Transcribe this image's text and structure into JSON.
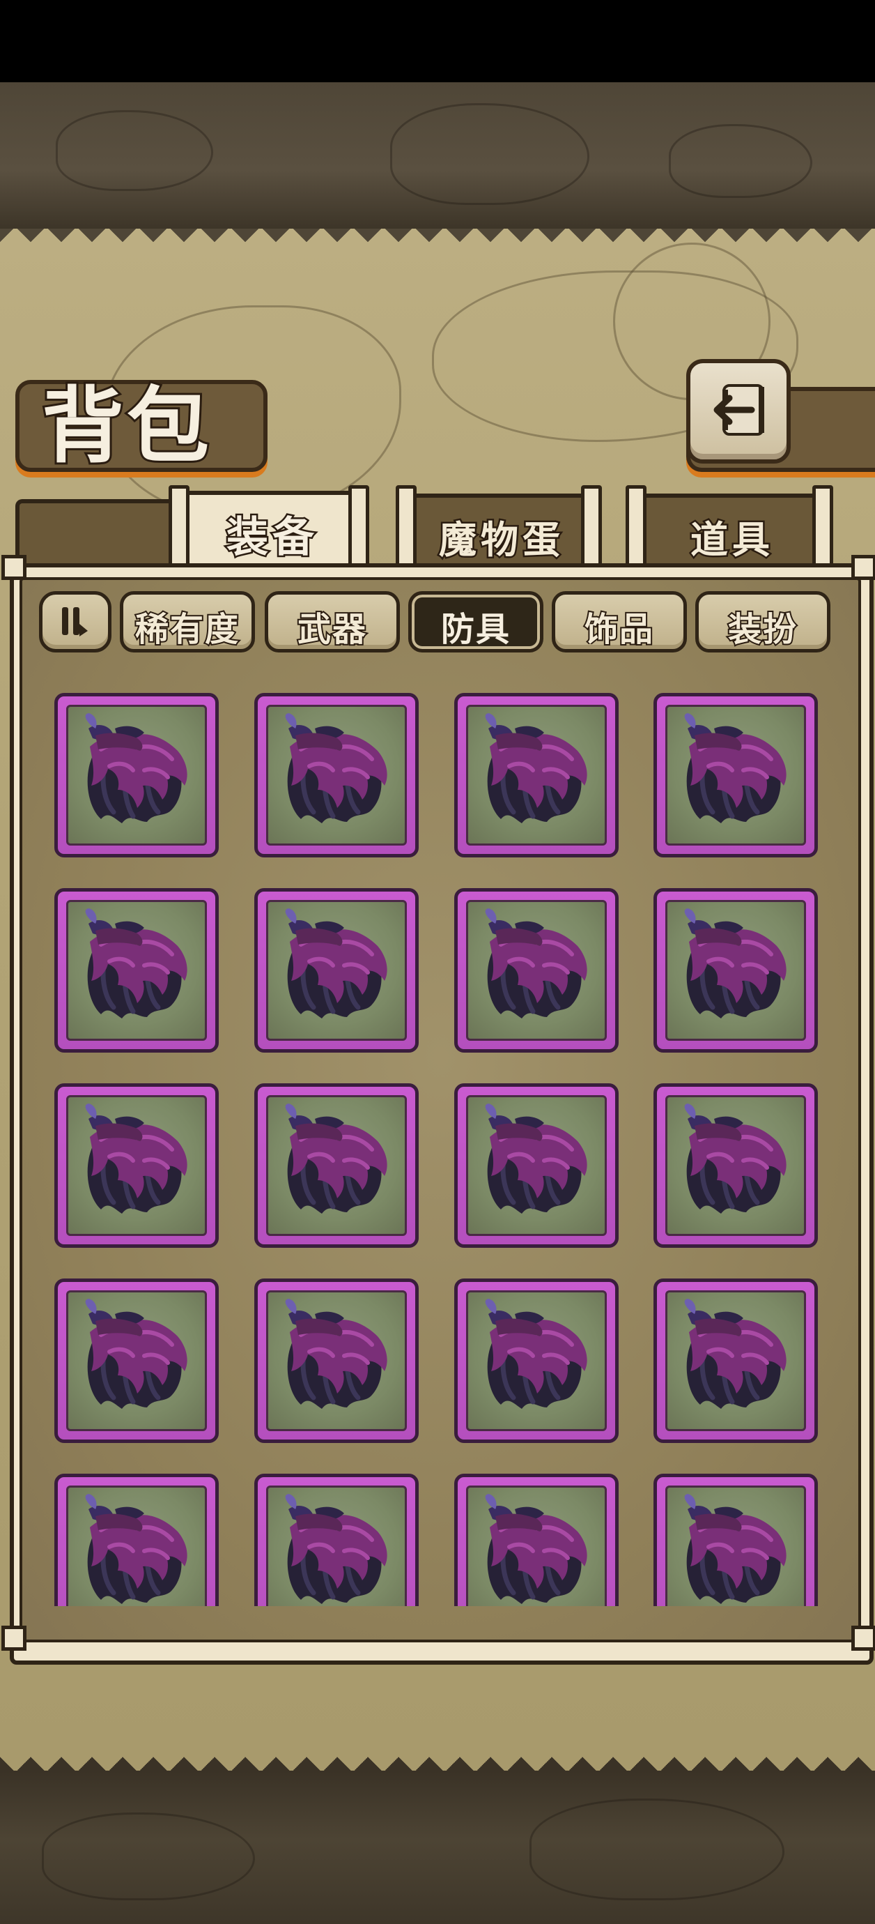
{
  "header": {
    "title": "背包",
    "back_icon": "back-arrow-icon"
  },
  "top_tabs": [
    {
      "label": "装备",
      "active": true
    },
    {
      "label": "魔物蛋",
      "active": false
    },
    {
      "label": "道具",
      "active": false
    }
  ],
  "filters": {
    "toggle_icon": "sort-toggle-icon",
    "items": [
      {
        "label": "稀有度",
        "active": false
      },
      {
        "label": "武器",
        "active": false
      },
      {
        "label": "防具",
        "active": true
      },
      {
        "label": "饰品",
        "active": false
      },
      {
        "label": "装扮",
        "active": false
      }
    ]
  },
  "inventory": {
    "item_icon": "purple-cloak-icon",
    "rarity_color": "#c95bd0",
    "slots": 20
  },
  "colors": {
    "accent_orange": "#d97b1e",
    "parchment": "#efe5cc",
    "dark_outline": "#2f2416"
  }
}
